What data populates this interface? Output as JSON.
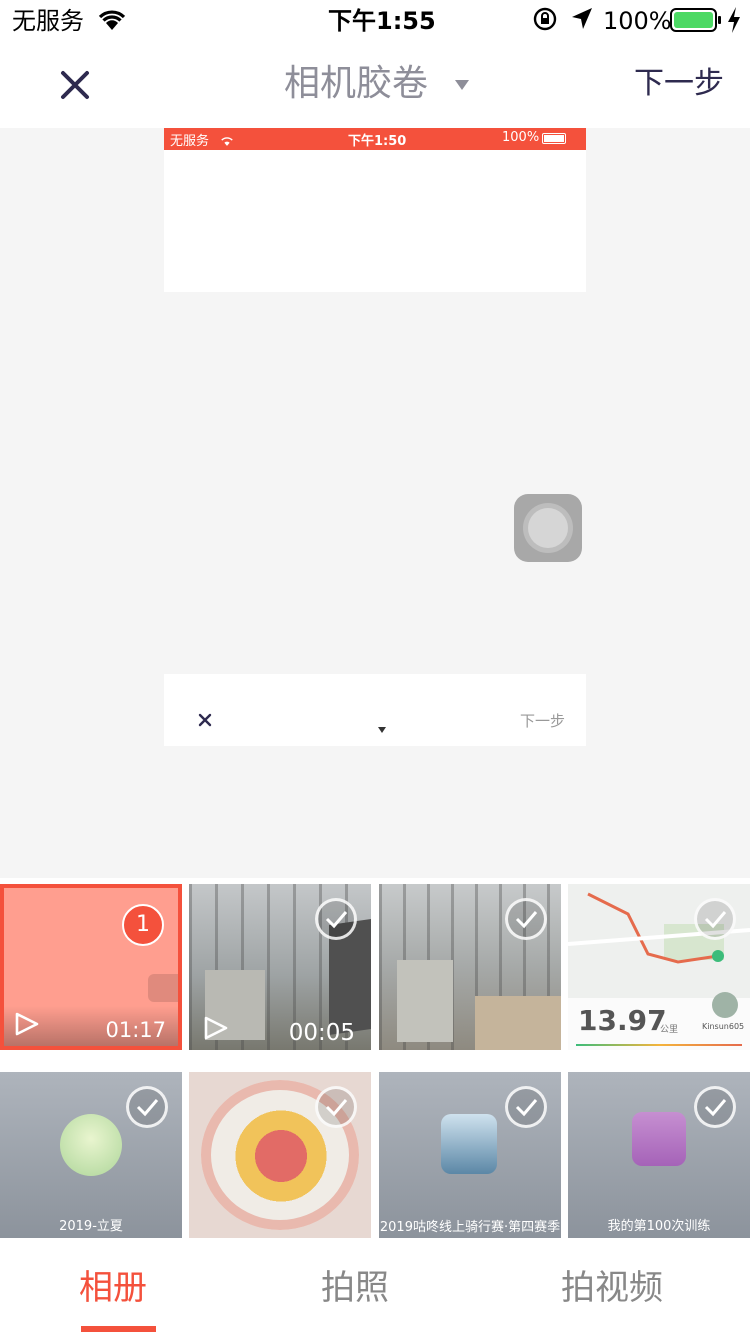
{
  "status_bar": {
    "carrier": "无服务",
    "time": "下午1:55",
    "battery": "100%"
  },
  "nav": {
    "title": "相机胶卷",
    "next": "下一步"
  },
  "preview": {
    "mini_status": {
      "carrier": "无服务",
      "time": "下午1:50",
      "battery": "100%"
    },
    "mini_nav": {
      "next": "下一步"
    }
  },
  "grid": {
    "selected_badge": "1",
    "items": [
      {
        "duration": "01:17"
      },
      {
        "duration": "00:05"
      },
      {},
      {
        "distance": "13.97",
        "unit": "公里",
        "user": "Kinsun605"
      },
      {
        "caption": "2019-立夏"
      },
      {},
      {
        "caption": "2019咕咚线上骑行赛·第四赛季"
      },
      {
        "caption": "我的第100次训练"
      }
    ]
  },
  "tabs": [
    {
      "label": "相册",
      "active": true
    },
    {
      "label": "拍照",
      "active": false
    },
    {
      "label": "拍视频",
      "active": false
    }
  ],
  "colors": {
    "accent": "#f4513c",
    "nav_icon": "#2e2a4f",
    "check_ring": "#ffffff"
  }
}
